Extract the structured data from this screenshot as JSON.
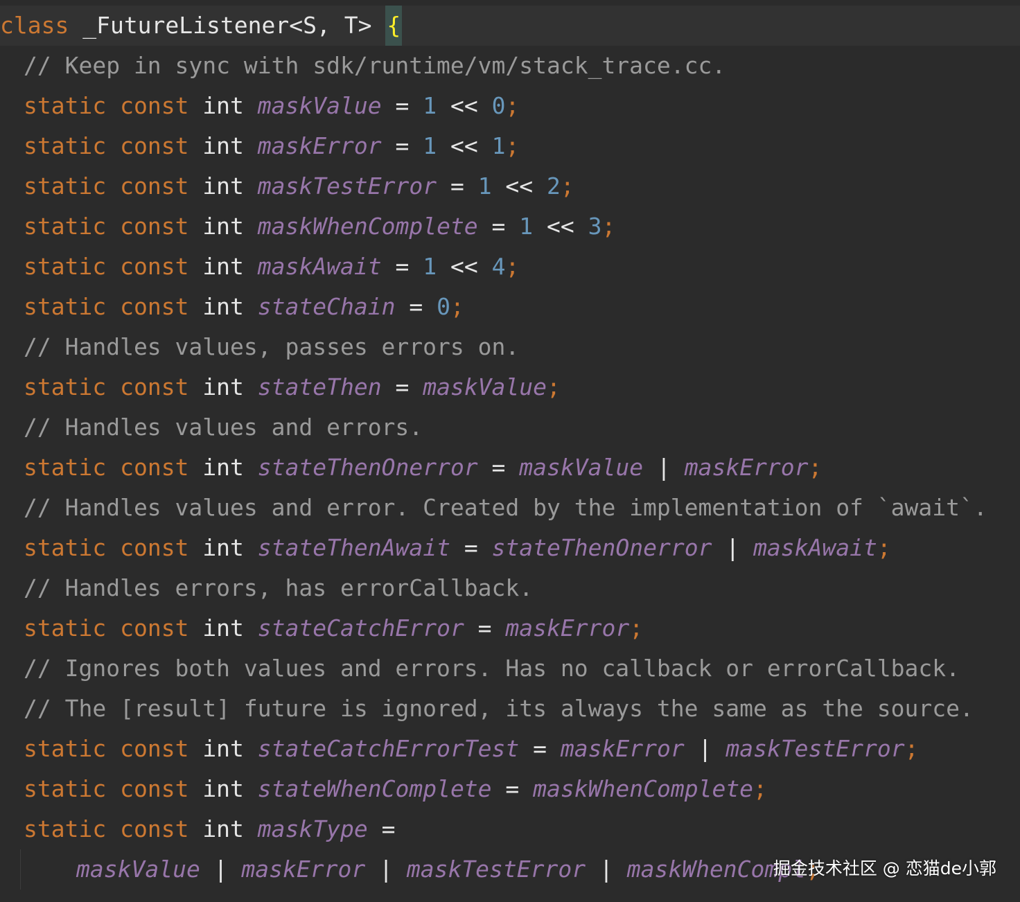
{
  "editor": {
    "theme_colors": {
      "background": "#2b2b2b",
      "keyword": "#cc7832",
      "field": "#9876aa",
      "number": "#6897bb",
      "comment": "#9a9a9a",
      "brace": "#ffef28"
    },
    "lines": {
      "l1": {
        "kw": "class",
        "name": " _FutureListener<S, T> ",
        "brace": "{"
      },
      "l2": {
        "comment": "// Keep in sync with sdk/runtime/vm/stack_trace.cc."
      },
      "l3": {
        "static": "static",
        "const": "const",
        "type": "int",
        "field": "maskValue",
        "eq": " = ",
        "lhs": "1",
        "shift": " << ",
        "rhs": "0",
        "semi": ";"
      },
      "l4": {
        "static": "static",
        "const": "const",
        "type": "int",
        "field": "maskError",
        "eq": " = ",
        "lhs": "1",
        "shift": " << ",
        "rhs": "1",
        "semi": ";"
      },
      "l5": {
        "static": "static",
        "const": "const",
        "type": "int",
        "field": "maskTestError",
        "eq": " = ",
        "lhs": "1",
        "shift": " << ",
        "rhs": "2",
        "semi": ";"
      },
      "l6": {
        "static": "static",
        "const": "const",
        "type": "int",
        "field": "maskWhenComplete",
        "eq": " = ",
        "lhs": "1",
        "shift": " << ",
        "rhs": "3",
        "semi": ";"
      },
      "l7": {
        "static": "static",
        "const": "const",
        "type": "int",
        "field": "maskAwait",
        "eq": " = ",
        "lhs": "1",
        "shift": " << ",
        "rhs": "4",
        "semi": ";"
      },
      "l8": {
        "static": "static",
        "const": "const",
        "type": "int",
        "field": "stateChain",
        "eq": " = ",
        "val": "0",
        "semi": ";"
      },
      "l9": {
        "comment": "// Handles values, passes errors on."
      },
      "l10": {
        "static": "static",
        "const": "const",
        "type": "int",
        "field": "stateThen",
        "eq": " = ",
        "ref1": "maskValue",
        "semi": ";"
      },
      "l11": {
        "comment": "// Handles values and errors."
      },
      "l12": {
        "static": "static",
        "const": "const",
        "type": "int",
        "field": "stateThenOnerror",
        "eq": " = ",
        "ref1": "maskValue",
        "or": " | ",
        "ref2": "maskError",
        "semi": ";"
      },
      "l13": {
        "comment": "// Handles values and error. Created by the implementation of `await`."
      },
      "l14": {
        "static": "static",
        "const": "const",
        "type": "int",
        "field": "stateThenAwait",
        "eq": " = ",
        "ref1": "stateThenOnerror",
        "or": " | ",
        "ref2": "maskAwait",
        "semi": ";"
      },
      "l15": {
        "comment": "// Handles errors, has errorCallback."
      },
      "l16": {
        "static": "static",
        "const": "const",
        "type": "int",
        "field": "stateCatchError",
        "eq": " = ",
        "ref1": "maskError",
        "semi": ";"
      },
      "l17": {
        "comment": "// Ignores both values and errors. Has no callback or errorCallback."
      },
      "l18": {
        "comment": "// The [result] future is ignored, its always the same as the source."
      },
      "l19": {
        "static": "static",
        "const": "const",
        "type": "int",
        "field": "stateCatchErrorTest",
        "eq": " = ",
        "ref1": "maskError",
        "or": " | ",
        "ref2": "maskTestError",
        "semi": ";"
      },
      "l20": {
        "static": "static",
        "const": "const",
        "type": "int",
        "field": "stateWhenComplete",
        "eq": " = ",
        "ref1": "maskWhenComplete",
        "semi": ";"
      },
      "l21": {
        "static": "static",
        "const": "const",
        "type": "int",
        "field": "maskType",
        "eq": " ="
      },
      "l22": {
        "ref1": "maskValue",
        "or1": " | ",
        "ref2": "maskError",
        "or2": " | ",
        "ref3": "maskTestError",
        "or3": " | ",
        "ref4": "maskWhenCompl",
        "semi": ";"
      }
    }
  },
  "watermark": {
    "text": "掘金技术社区 @ 恋猫de小郭"
  }
}
